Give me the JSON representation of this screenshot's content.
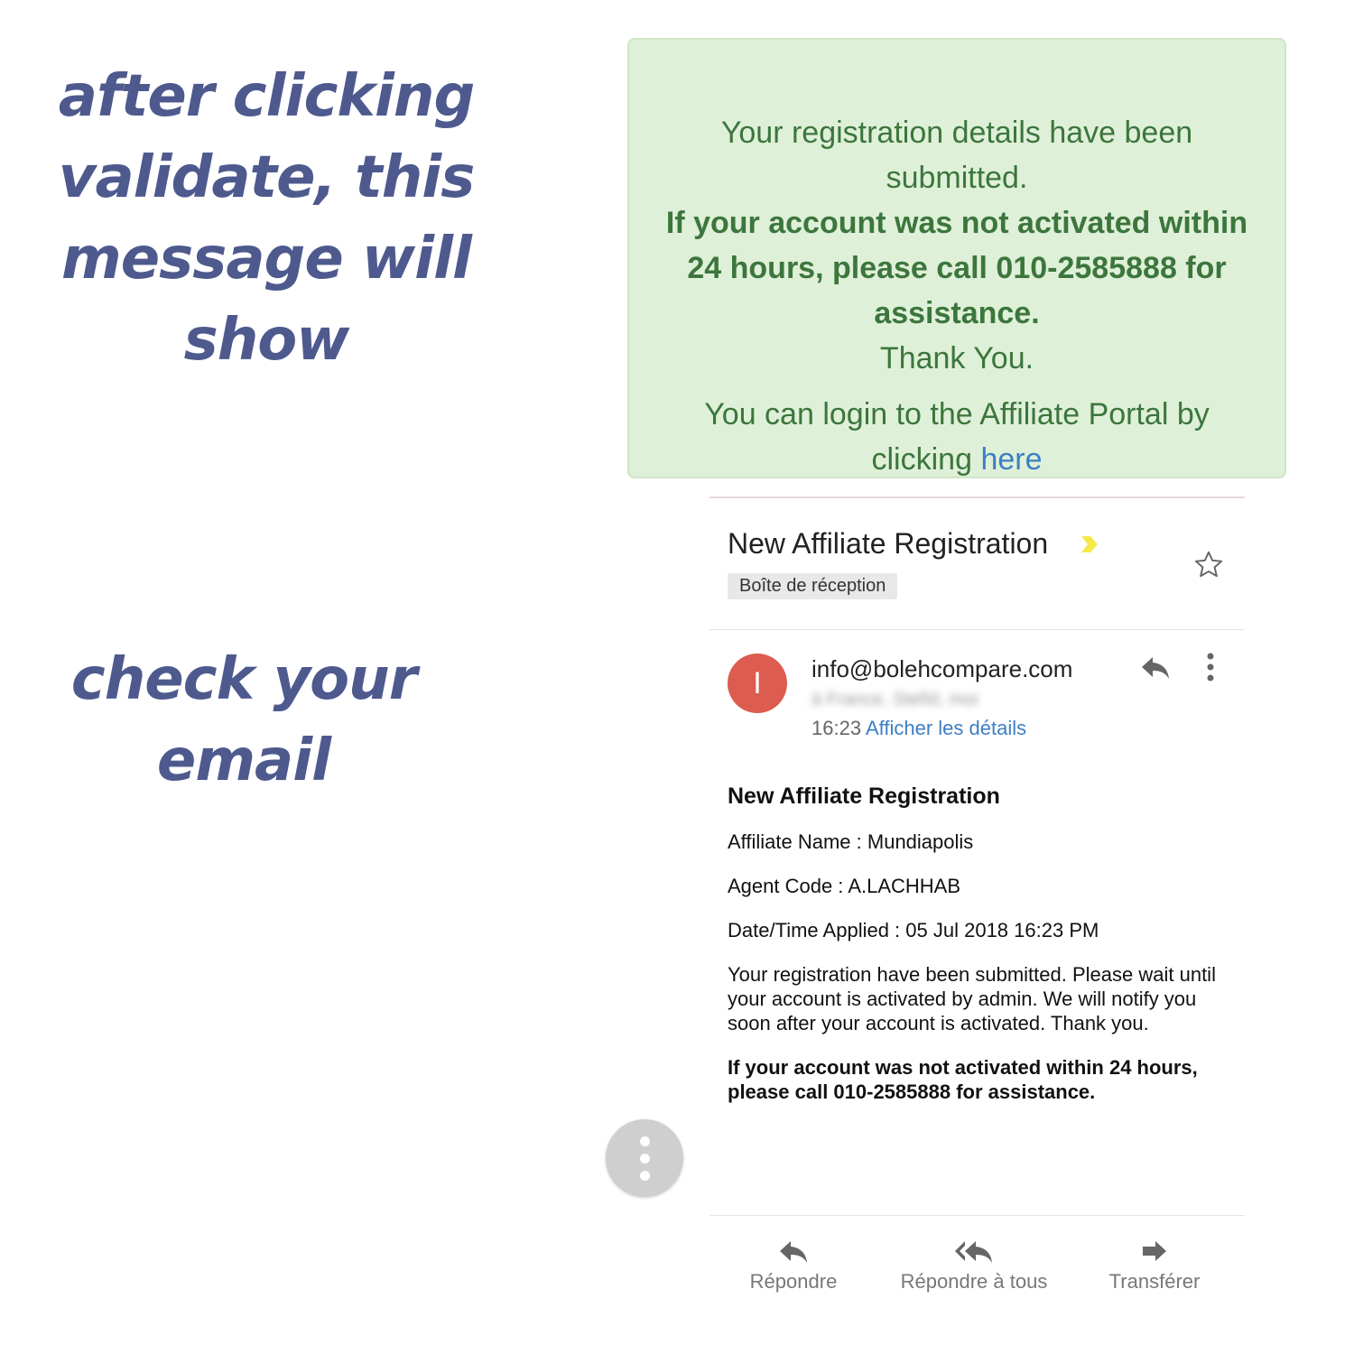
{
  "captions": {
    "top": "after clicking validate, this message will show",
    "bottom": "check your email"
  },
  "success_alert": {
    "line1": "Your registration details have been submitted.",
    "line2_bold": "If your account was not activated within 24 hours, please call 010-2585888 for assistance.",
    "line3": "Thank You.",
    "line4_prefix": "You can login to the Affiliate Portal by clicking",
    "line4_link": "here"
  },
  "email": {
    "subject": "New Affiliate Registration",
    "label": "Boîte de réception",
    "sender_initial": "I",
    "sender": "info@bolehcompare.com",
    "recipients": "à France, Stefid, moi",
    "time": "16:23",
    "details_link": "Afficher les détails",
    "body": {
      "heading": "New Affiliate Registration",
      "affiliate_name": "Affiliate Name : Mundiapolis",
      "agent_code": "Agent Code : A.LACHHAB",
      "date_applied": "Date/Time Applied : 05 Jul 2018 16:23 PM",
      "message": "Your registration have been submitted. Please wait until your account is activated by admin. We will notify you soon after your account is activated. Thank you.",
      "note_bold": "If your account was not activated within 24 hours, please call 010-2585888 for assistance."
    }
  },
  "actions": {
    "reply": "Répondre",
    "reply_all": "Répondre à tous",
    "forward": "Transférer"
  },
  "icons": [
    "label-arrow-icon",
    "star-icon",
    "reply-icon",
    "more-vert-icon",
    "reply-all-icon",
    "forward-icon"
  ],
  "colors": {
    "caption": "#4e5a8e",
    "alert_bg": "#dff0d8",
    "alert_text": "#3c763d",
    "link": "#3c7fc4",
    "avatar": "#dc5c4f"
  }
}
